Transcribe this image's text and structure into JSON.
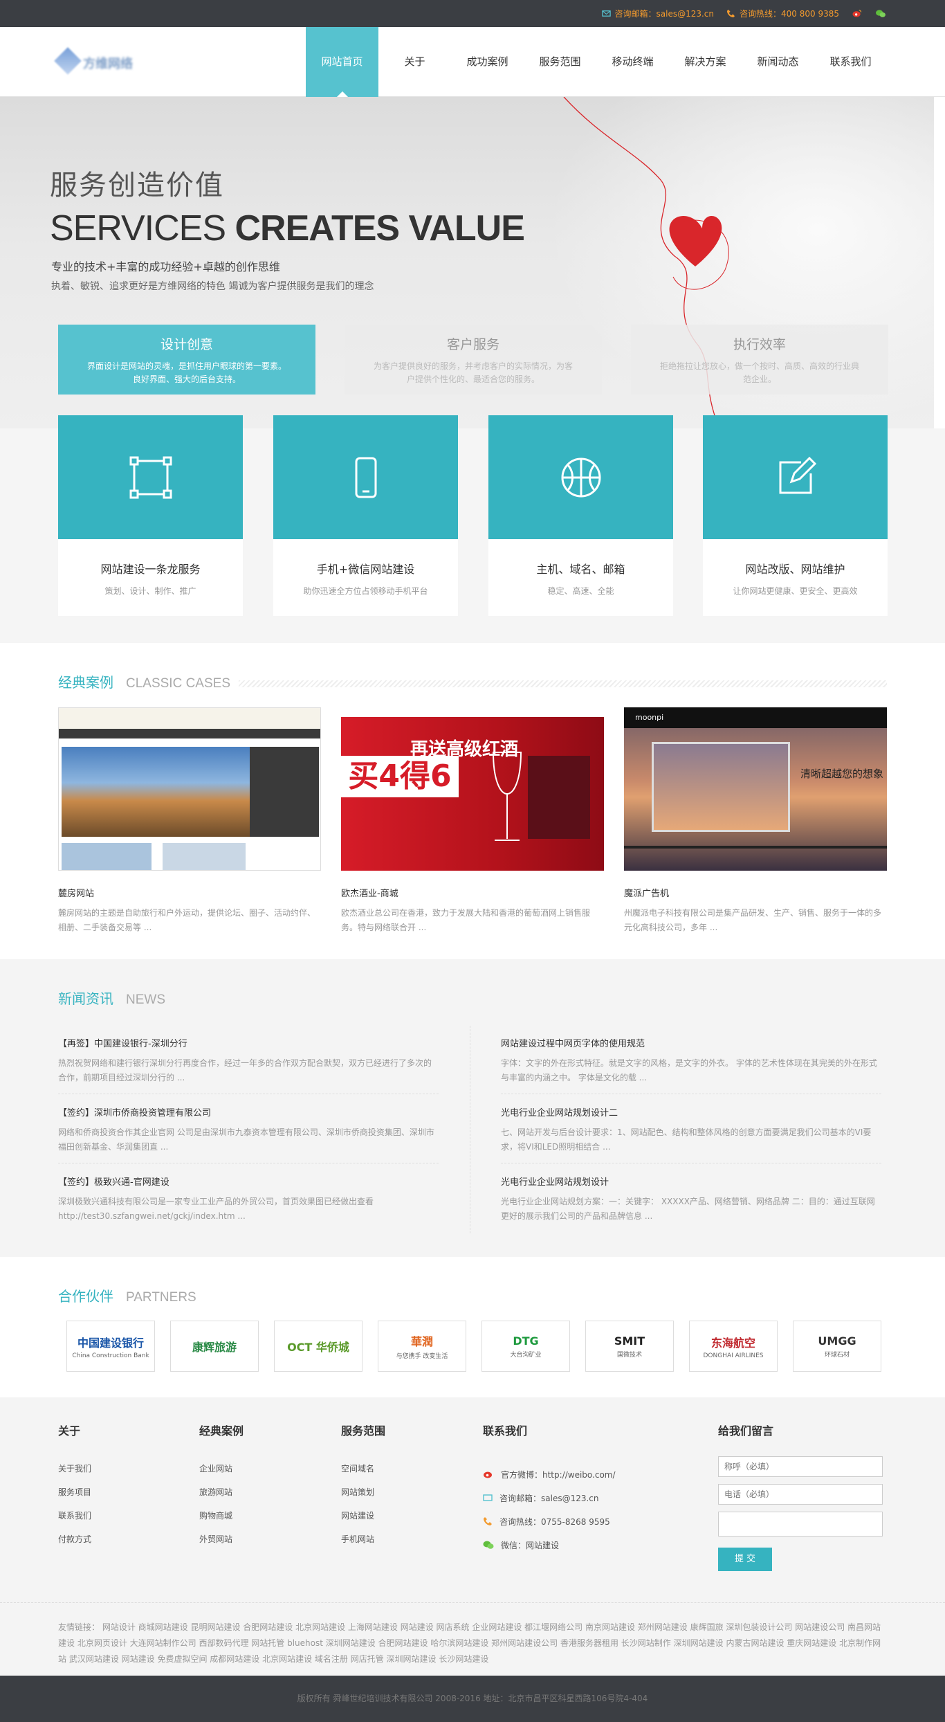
{
  "topbar": {
    "email": "咨询邮箱：sales@123.cn",
    "hotline": "咨询热线：400 800 9385"
  },
  "header": {
    "logo_text": "方维网络",
    "nav": [
      "网站首页",
      "关于",
      "成功案例",
      "服务范围",
      "移动终端",
      "解决方案",
      "新闻动态",
      "联系我们"
    ]
  },
  "hero": {
    "title": "服务创造价值",
    "subtitle_light": "SERVICES ",
    "subtitle_bold": "CREATES VALUE",
    "line1": "专业的技术+丰富的成功经验+卓越的创作思维",
    "line2": "执着、敏锐、追求更好是方维网络的特色  竭诚为客户提供服务是我们的理念",
    "features": [
      {
        "title": "设计创意",
        "desc": "界面设计是网站的灵魂，是抓住用户眼球的第一要素。良好界面、强大的后台支持。"
      },
      {
        "title": "客户服务",
        "desc": "为客户提供良好的服务，并考虑客户的实际情况，为客户提供个性化的、最适合您的服务。"
      },
      {
        "title": "执行效率",
        "desc": "拒绝拖拉让您放心，做一个按时、高质、高效的行业典范企业。"
      }
    ]
  },
  "services": [
    {
      "title": "网站建设一条龙服务",
      "desc": "策划、设计、制作、推广"
    },
    {
      "title": "手机+微信网站建设",
      "desc": "助你迅速全方位占领移动手机平台"
    },
    {
      "title": "主机、域名、邮箱",
      "desc": "稳定、高速、全能"
    },
    {
      "title": "网站改版、网站维护",
      "desc": "让你网站更健康、更安全、更高效"
    }
  ],
  "cases": {
    "title": "经典案例",
    "en": "CLASSIC CASES",
    "items": [
      {
        "title": "麓房网站",
        "desc": "麓房网站的主题是自助旅行和户外运动，提供论坛、圈子、活动约伴、相册、二手装备交易等 ..."
      },
      {
        "title": "欧杰酒业-商城",
        "desc": "欧杰酒业总公司在香港，致力于发展大陆和香港的葡萄酒网上销售服务。特与网络联合开 ..."
      },
      {
        "title": "魔派广告机",
        "desc": "州魔派电子科技有限公司是集产品研发、生产、销售、服务于一体的多元化高科技公司，多年 ..."
      }
    ],
    "shot2_text": "买4得6",
    "shot2_banner": "再送高级红酒",
    "shot3_text": "清晰超越您的想象",
    "shot3_brand": "moonpi"
  },
  "news": {
    "title": "新闻资讯",
    "en": "NEWS",
    "items": [
      {
        "title": "【再签】中国建设银行-深圳分行",
        "desc": "热烈祝贺网络和建行银行深圳分行再度合作，经过一年多的合作双方配合默契，双方已经进行了多次的合作，前期项目经过深圳分行的 ..."
      },
      {
        "title": "【签约】深圳市侨商投资管理有限公司",
        "desc": "网络和侨商投资合作其企业官网 公司是由深圳市九泰资本管理有限公司、深圳市侨商投资集团、深圳市福田创新基金、华润集团直 ..."
      },
      {
        "title": "【签约】极致兴通-官网建设",
        "desc": "深圳极致兴通科技有限公司是一家专业工业产品的外贸公司，首页效果图已经做出查看 http://test30.szfangwei.net/gckj/index.htm ..."
      },
      {
        "title": "网站建设过程中网页字体的使用规范",
        "desc": "字体：文字的外在形式特征。就是文字的风格，是文字的外衣。 字体的艺术性体现在其完美的外在形式与丰富的内涵之中。 字体是文化的载 ..."
      },
      {
        "title": "光电行业企业网站规划设计二",
        "desc": "七、网站开发与后台设计要求：1、网站配色、结构和整体风格的创意方面要满足我们公司基本的VI要求，将VI和LED照明相结合 ..."
      },
      {
        "title": "光电行业企业网站规划设计",
        "desc": "光电行业企业网站规划方案：一：关键字： XXXXX产品、网络营销、网络品牌 二：目的：通过互联网更好的展示我们公司的产品和品牌信息 ..."
      }
    ]
  },
  "partners": {
    "title": "合作伙伴",
    "en": "PARTNERS",
    "items": [
      {
        "name": "中国建设银行",
        "sub": "China Construction Bank",
        "color": "#1a56a8"
      },
      {
        "name": "康辉旅游",
        "sub": "",
        "color": "#2a8a46"
      },
      {
        "name": "OCT 华侨城",
        "sub": "",
        "color": "#5a9a2a"
      },
      {
        "name": "華潤",
        "sub": "与您携手 改变生活",
        "color": "#e0641e"
      },
      {
        "name": "DTG",
        "sub": "大台沟矿业",
        "color": "#1e9a3e"
      },
      {
        "name": "SMIT",
        "sub": "国微技术",
        "color": "#222222"
      },
      {
        "name": "东海航空",
        "sub": "DONGHAI AIRLINES",
        "color": "#c0282e"
      },
      {
        "name": "UMGG",
        "sub": "环球石材",
        "color": "#333333"
      }
    ]
  },
  "footer": {
    "cols": [
      {
        "title": "关于",
        "items": [
          "关于我们",
          "服务项目",
          "联系我们",
          "付款方式"
        ]
      },
      {
        "title": "经典案例",
        "items": [
          "企业网站",
          "旅游网站",
          "购物商城",
          "外贸网站"
        ]
      },
      {
        "title": "服务范围",
        "items": [
          "空间域名",
          "网站策划",
          "网站建设",
          "手机网站"
        ]
      }
    ],
    "contact": {
      "title": "联系我们",
      "weibo": "官方微博：http://weibo.com/",
      "email": "咨询邮箱：sales@123.cn",
      "phone": "咨询热线：0755-8268 9595",
      "wechat": "微信：网站建设"
    },
    "form": {
      "title": "给我们留言",
      "name_ph": "称呼（必填）",
      "phone_ph": "电话（必填）",
      "submit": "提 交"
    },
    "links": "友情链接： 网站设计 商城网站建设 昆明网站建设 合肥网站建设 北京网站建设 上海网站建设 网站建设 网店系统 企业网站建设 都江堰网络公司 南京网站建设 郑州网站建设 康辉国旅 深圳包装设计公司 网站建设公司 南昌网站建设 北京网页设计 大连网站制作公司 西部数码代理 网站托管 bluehost 深圳网站建设 合肥网站建设 哈尔滨网站建设 郑州网站建设公司 香港服务器租用 长沙网站制作 深圳网站建设 内蒙古网站建设 重庆网站建设 北京制作网站 武汉网站建设 网站建设 免费虚拟空间 成都网站建设 北京网站建设 域名注册 网店托管 深圳网站建设 长沙网站建设",
    "copyright": "版权所有 舜峰世纪培训技术有限公司 2008-2016   地址：北京市昌平区科星西路106号院4-404"
  }
}
